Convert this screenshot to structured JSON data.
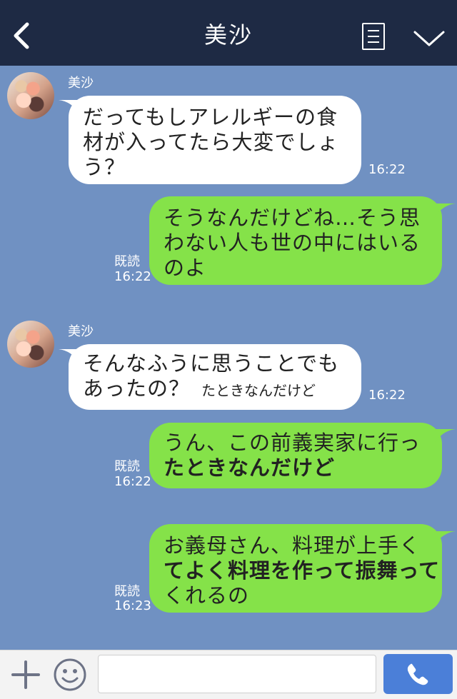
{
  "header": {
    "title": "美沙"
  },
  "messages": [
    {
      "sender": "美沙",
      "lines": [
        "だってもしアレルギーの食",
        "材が入ってたら大変でしょ",
        "う？"
      ],
      "time": "16:22"
    },
    {
      "lines": [
        "そうなんだけどね…そう思",
        "わない人も世の中にはいる",
        "のよ"
      ],
      "receipt": "既読",
      "time": "16:22"
    },
    {
      "sender": "美沙",
      "lines": [
        "そんなふうに思うことでも",
        "あったの？"
      ],
      "overlay": "たときなんだけど",
      "time": "16:22"
    },
    {
      "lines": [
        "うん、この前義実家に行っ",
        "たときなんだけど"
      ],
      "receipt": "既読",
      "time": "16:22"
    },
    {
      "lines": [
        "お義母さん、料理が上手く",
        "てよく料理を作って振舞って",
        "くれるの"
      ],
      "receipt": "既読",
      "time": "16:23"
    }
  ],
  "input": {
    "value": "",
    "placeholder": ""
  },
  "colors": {
    "header_bg": "#1e2a44",
    "chat_bg": "#7091c2",
    "incoming_bubble": "#ffffff",
    "outgoing_bubble": "#85e249",
    "call_button": "#4b7fd8"
  },
  "icons": [
    "back-icon",
    "menu-icon",
    "chevron-down-icon",
    "plus-icon",
    "smiley-icon",
    "phone-icon"
  ]
}
